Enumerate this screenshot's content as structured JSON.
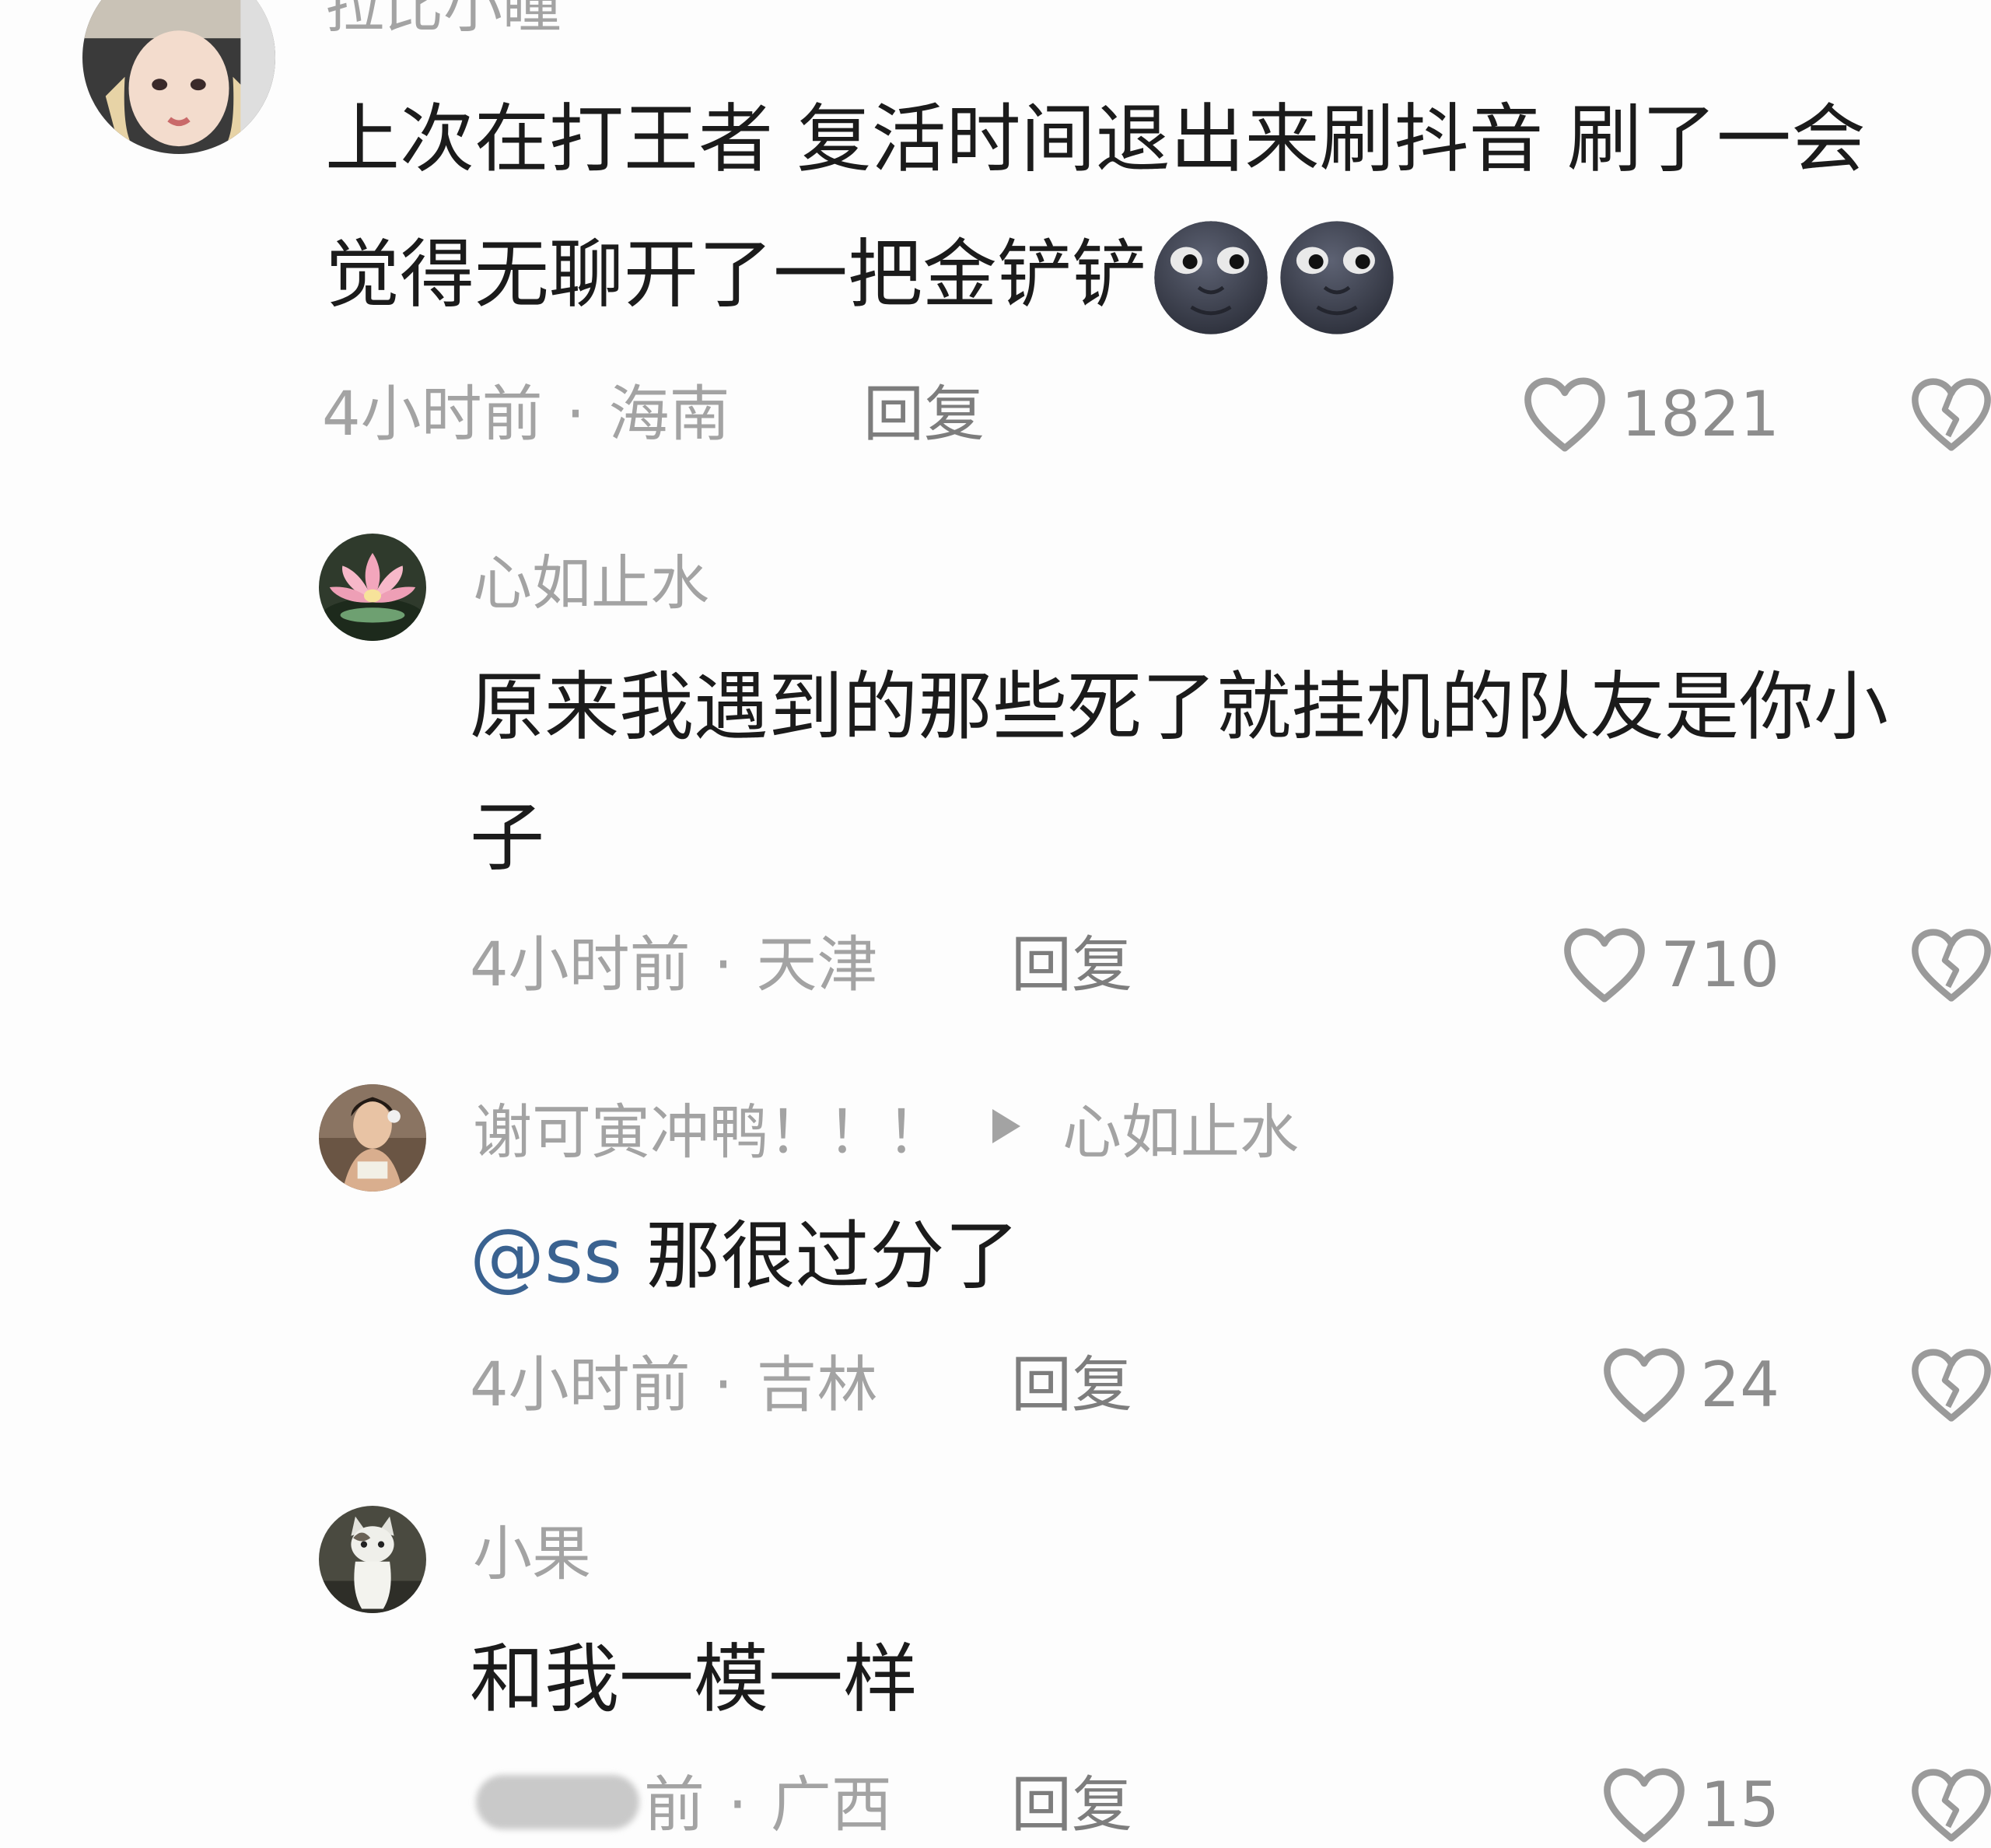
{
  "comments": [
    {
      "username": "拉比小瞳",
      "text_line1": "上次在打王者 复活时间退出来刷抖音 刷了一会",
      "text_line2": "觉得无聊开了一把金铲铲",
      "emojis": [
        "new-moon-face-icon",
        "new-moon-face-icon"
      ],
      "time": "4小时前",
      "location": "海南",
      "reply_label": "回复",
      "likes": "1821"
    },
    {
      "username": "心如止水",
      "text_line1": "原来我遇到的那些死了就挂机的队友是你小",
      "text_line2": "子",
      "time": "4小时前",
      "location": "天津",
      "reply_label": "回复",
      "likes": "710"
    },
    {
      "username": "谢可寅冲鸭！！！",
      "reply_to": "心如止水",
      "mention": "@ss",
      "text": "那很过分了",
      "time": "4小时前",
      "location": "吉林",
      "reply_label": "回复",
      "likes": "24"
    },
    {
      "username": "小果",
      "text": "和我一模一样",
      "time_partial": "前",
      "location": "广西",
      "reply_label": "回复",
      "likes": "15"
    }
  ],
  "meta_separator": "·",
  "colors": {
    "background": "#fdfdfd",
    "text": "#1b1b1b",
    "muted": "#a3a3a3",
    "mention": "#3a6290"
  }
}
